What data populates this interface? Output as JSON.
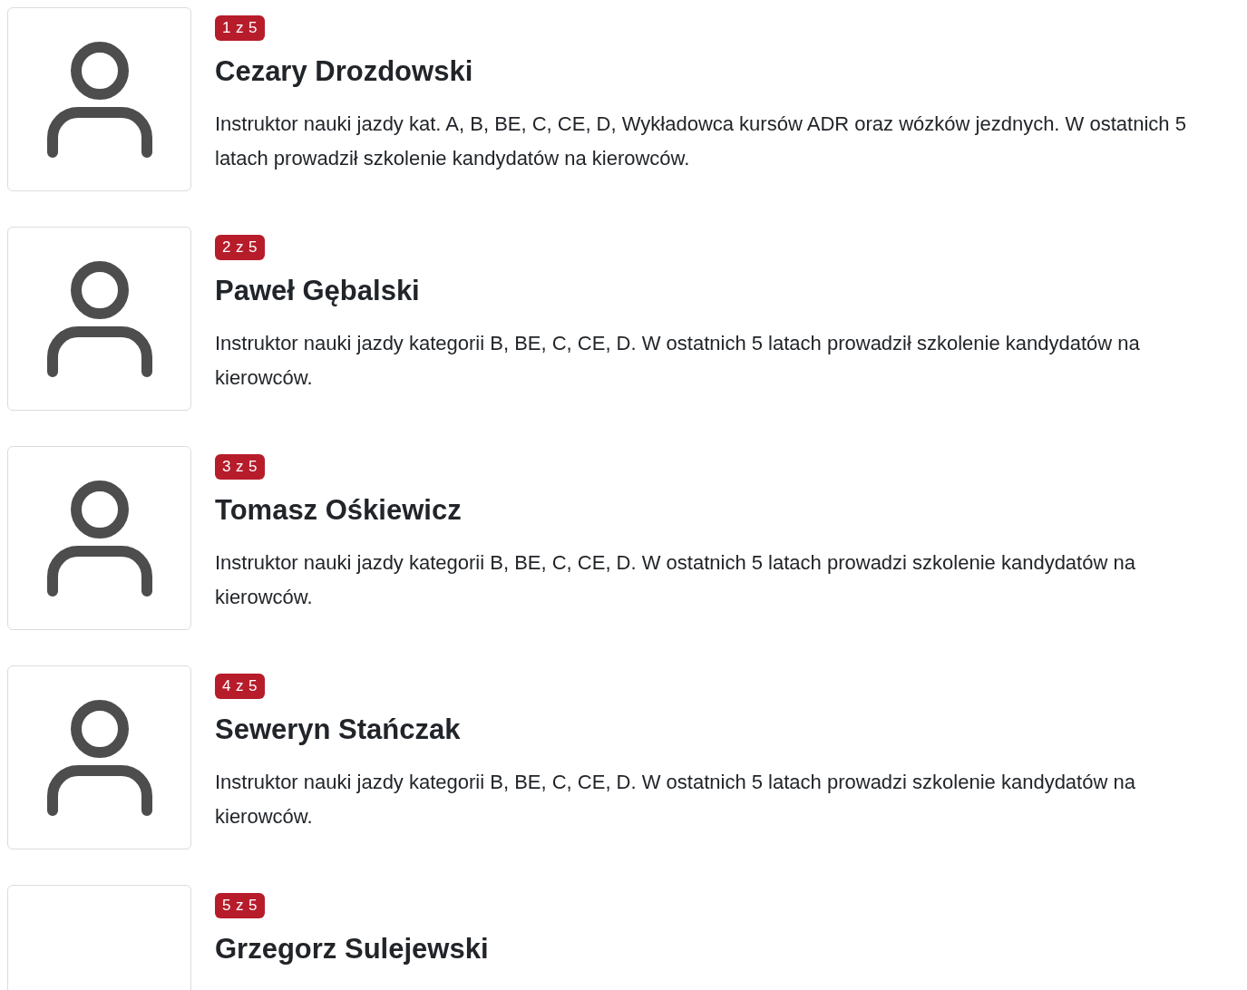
{
  "instructors": [
    {
      "badge": "1 z 5",
      "name": "Cezary Drozdowski",
      "avatar_icon": true,
      "description": "Instruktor nauki jazdy kat. A, B, BE, C, CE, D, Wykładowca kursów ADR oraz wózków jezdnych. W ostatnich 5 latach prowadził szkolenie kandydatów na kierowców."
    },
    {
      "badge": "2 z 5",
      "name": "Paweł Gębalski",
      "avatar_icon": true,
      "description": "Instruktor nauki jazdy kategorii B, BE, C, CE, D. W ostatnich 5 latach prowadził szkolenie kandydatów na kierowców."
    },
    {
      "badge": "3 z 5",
      "name": "Tomasz Ośkiewicz",
      "avatar_icon": true,
      "description": "Instruktor nauki jazdy kategorii B, BE, C, CE, D. W ostatnich 5 latach prowadzi szkolenie kandydatów na kierowców."
    },
    {
      "badge": "4 z 5",
      "name": "Seweryn Stańczak",
      "avatar_icon": true,
      "description": "Instruktor nauki jazdy kategorii B, BE, C, CE, D. W ostatnich 5 latach prowadzi szkolenie kandydatów na kierowców."
    },
    {
      "badge": "5 z 5",
      "name": "Grzegorz Sulejewski",
      "avatar_icon": false
    }
  ]
}
